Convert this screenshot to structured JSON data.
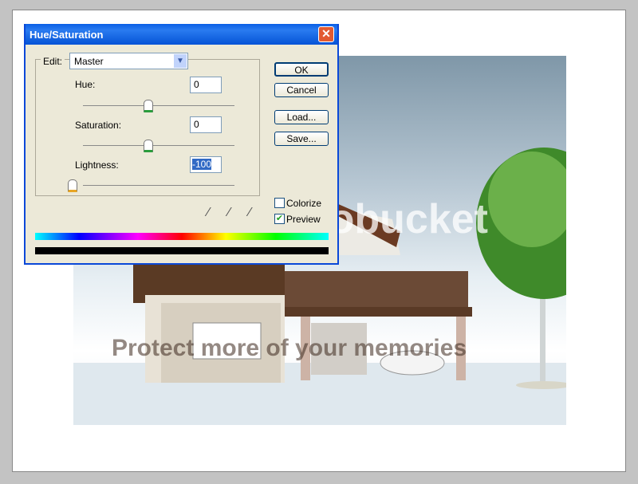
{
  "dialog": {
    "title": "Hue/Saturation",
    "edit_label": "Edit:",
    "edit_value": "Master",
    "hue_label": "Hue:",
    "hue_value": "0",
    "saturation_label": "Saturation:",
    "saturation_value": "0",
    "lightness_label": "Lightness:",
    "lightness_value": "-100",
    "buttons": {
      "ok": "OK",
      "cancel": "Cancel",
      "load": "Load...",
      "save": "Save..."
    },
    "colorize_label": "Colorize",
    "colorize_checked": false,
    "preview_label": "Preview",
    "preview_checked": true,
    "icons": [
      "eyedropper-icon",
      "eyedropper-plus-icon",
      "eyedropper-minus-icon"
    ]
  },
  "watermark": {
    "logo": "photobucket",
    "tagline": "Protect more of your memories"
  },
  "colors": {
    "titlebar": "#0a5fe6",
    "dialog_bg": "#ece9d8",
    "close": "#e25a32"
  }
}
